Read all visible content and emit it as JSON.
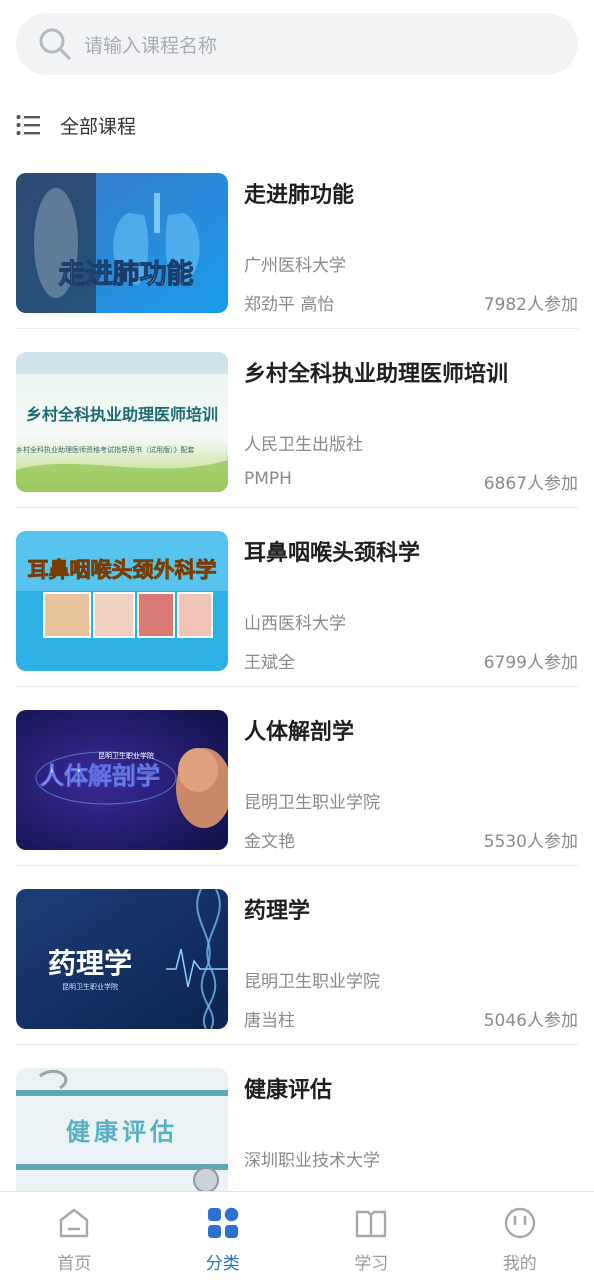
{
  "search": {
    "placeholder": "请输入课程名称",
    "icon": "search-icon"
  },
  "section": {
    "label": "全部课程",
    "icon": "list-icon"
  },
  "courses": [
    {
      "title": "走进肺功能",
      "org": "广州医科大学",
      "teacher": "郑劲平 高怡",
      "count": "7982人参加",
      "cover_text": "走进肺功能"
    },
    {
      "title": "乡村全科执业助理医师培训",
      "org": "人民卫生出版社",
      "teacher": "PMPH",
      "count": "6867人参加",
      "cover_text": "乡村全科执业助理医师培训",
      "cover_subtext": "乡村全科执业助理医师资格考试指导用书（试用版）》配套"
    },
    {
      "title": "耳鼻咽喉头颈科学",
      "org": "山西医科大学",
      "teacher": "王斌全",
      "count": "6799人参加",
      "cover_text": "耳鼻咽喉头颈外科学"
    },
    {
      "title": "人体解剖学",
      "org": "昆明卫生职业学院",
      "teacher": "金文艳",
      "count": "5530人参加",
      "cover_text": "人体解剖学",
      "cover_subtext": "昆明卫生职业学院"
    },
    {
      "title": "药理学",
      "org": "昆明卫生职业学院",
      "teacher": "唐当柱",
      "count": "5046人参加",
      "cover_text": "药理学",
      "cover_subtext": "昆明卫生职业学院"
    },
    {
      "title": "健康评估",
      "org": "深圳职业技术大学",
      "teacher": "",
      "count": "",
      "cover_text": "健康评估"
    }
  ],
  "tabs": [
    {
      "label": "首页",
      "icon": "home-icon",
      "active": false
    },
    {
      "label": "分类",
      "icon": "category-grid-icon",
      "active": true
    },
    {
      "label": "学习",
      "icon": "book-icon",
      "active": false
    },
    {
      "label": "我的",
      "icon": "profile-face-icon",
      "active": false
    }
  ],
  "colors": {
    "accent": "#2f6fcf",
    "muted_text": "#8a8a8a",
    "search_bg": "#f2f3f5"
  }
}
